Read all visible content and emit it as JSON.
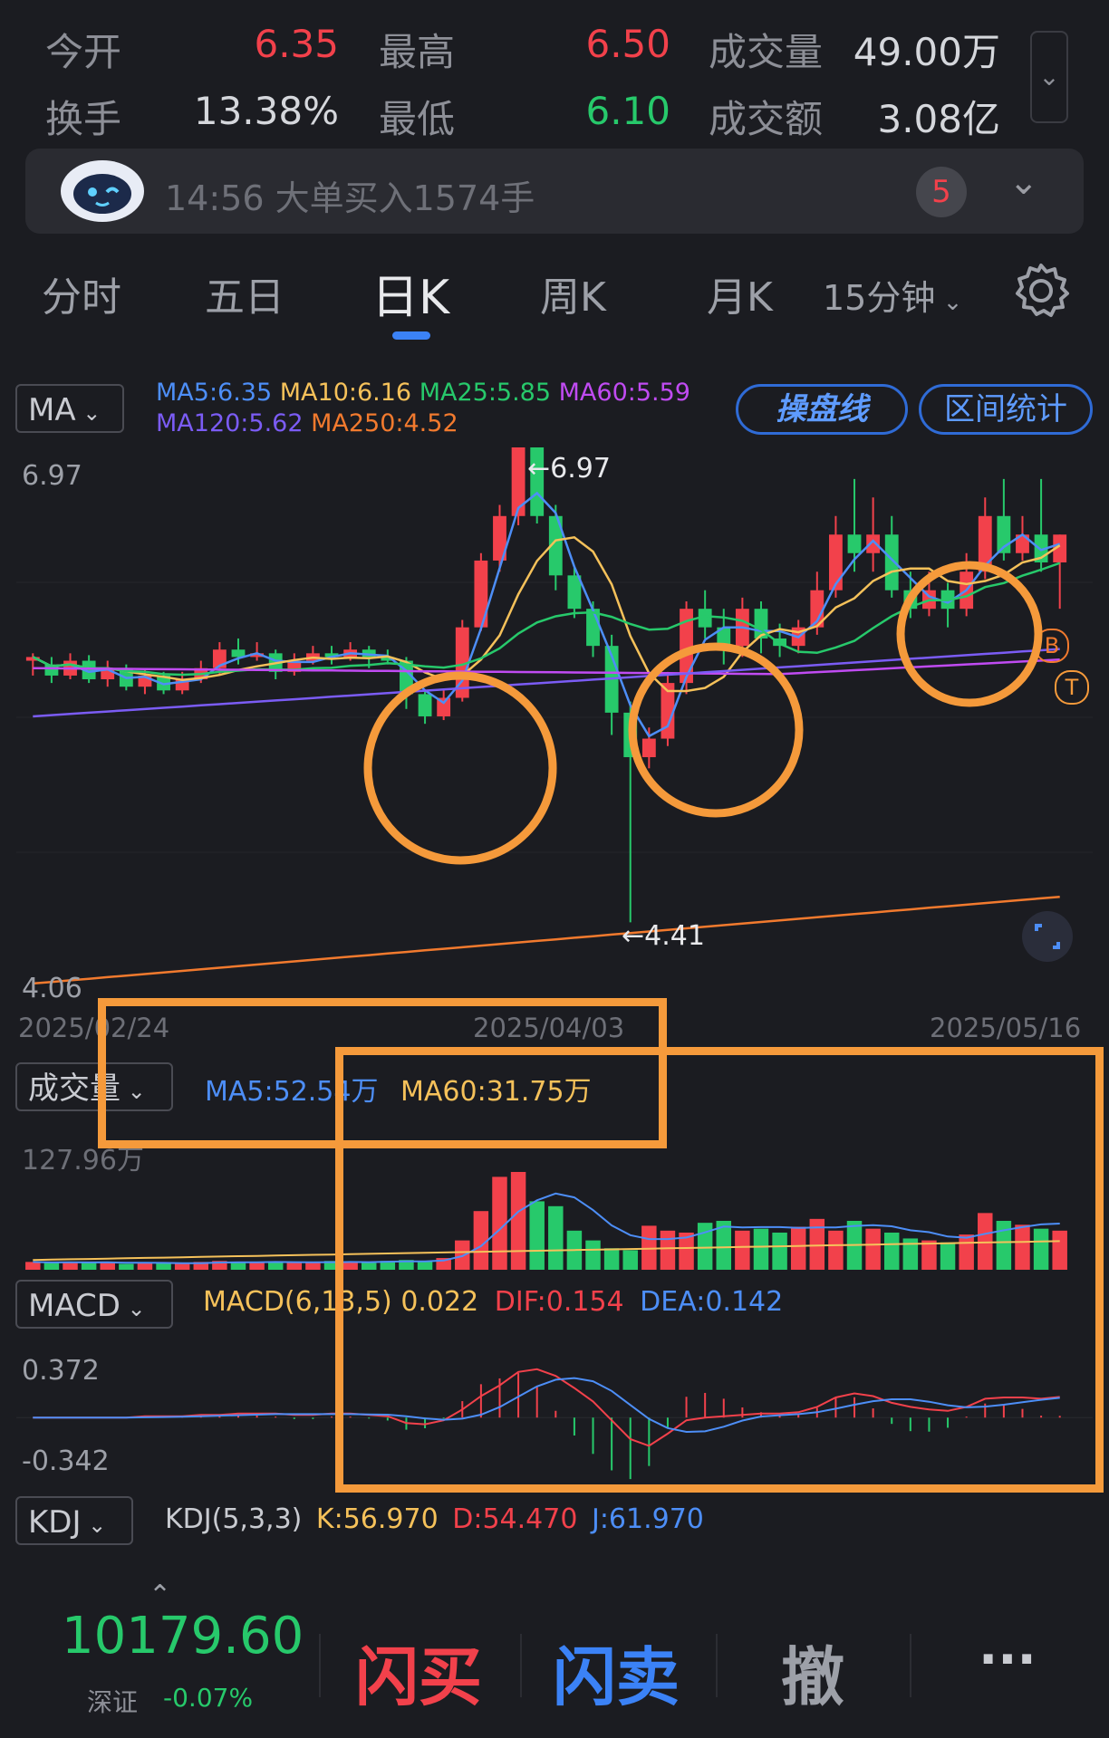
{
  "quote": {
    "open_label": "今开",
    "open_value": "6.35",
    "high_label": "最高",
    "high_value": "6.50",
    "volume_label": "成交量",
    "volume_value": "49.00万",
    "turnover_label": "换手",
    "turnover_value": "13.38%",
    "low_label": "最低",
    "low_value": "6.10",
    "amount_label": "成交额",
    "amount_value": "3.08亿"
  },
  "notice": {
    "text": "14:56 大单买入1574手",
    "badge": "5"
  },
  "tabs": [
    "分时",
    "五日",
    "日K",
    "周K",
    "月K",
    "15分钟"
  ],
  "active_tab": "日K",
  "main_chart": {
    "indicator_select": "MA",
    "ma_legend": [
      {
        "text": "MA5:6.35",
        "color": "#4d8ef7"
      },
      {
        "text": "MA10:6.16",
        "color": "#f5c15a"
      },
      {
        "text": "MA25:5.85",
        "color": "#27c96b"
      },
      {
        "text": "MA60:5.59",
        "color": "#c04bf2"
      },
      {
        "text": "MA120:5.62",
        "color": "#7b5cf5"
      },
      {
        "text": "MA250:4.52",
        "color": "#f27a2e"
      }
    ],
    "btn_caopanxian": "操盘线",
    "btn_interval": "区间统计",
    "y_top": "6.97",
    "y_bottom": "4.06",
    "max_mark": "←6.97",
    "min_mark": "←4.41",
    "dates": [
      "2025/02/24",
      "2025/04/03",
      "2025/05/16"
    ],
    "marker_b": "B",
    "marker_t": "T"
  },
  "volume_panel": {
    "select": "成交量",
    "ma5": "MA5:52.54万",
    "ma60": "MA60:31.75万",
    "y_top": "127.96万"
  },
  "macd_panel": {
    "select": "MACD",
    "params": "MACD(6,13,5)",
    "macd": "0.022",
    "dif": "DIF:0.154",
    "dea": "DEA:0.142",
    "y_top": "0.372",
    "y_bottom": "-0.342"
  },
  "kdj_panel": {
    "select": "KDJ",
    "params": "KDJ(5,3,3)",
    "k": "K:56.970",
    "d": "D:54.470",
    "j": "J:61.970"
  },
  "bottom": {
    "index_value": "10179.60",
    "index_name": "深证",
    "index_change": "-0.07%",
    "quick_buy": "闪买",
    "quick_sell": "闪卖",
    "cancel": "撤",
    "more": "···"
  },
  "colors": {
    "up": "#f2414b",
    "down": "#27c96b",
    "accent": "#3b82f6",
    "highlight": "#f59a3b"
  },
  "chart_data": {
    "type": "candlestick",
    "y_range": [
      4.06,
      6.97
    ],
    "x_range": [
      "2025/02/24",
      "2025/05/16"
    ],
    "candles": [
      [
        5.82,
        5.84,
        5.86,
        5.74
      ],
      [
        5.8,
        5.74,
        5.84,
        5.7
      ],
      [
        5.74,
        5.82,
        5.86,
        5.72
      ],
      [
        5.82,
        5.72,
        5.85,
        5.7
      ],
      [
        5.72,
        5.78,
        5.82,
        5.68
      ],
      [
        5.78,
        5.68,
        5.8,
        5.66
      ],
      [
        5.68,
        5.74,
        5.78,
        5.64
      ],
      [
        5.74,
        5.66,
        5.76,
        5.64
      ],
      [
        5.66,
        5.72,
        5.76,
        5.64
      ],
      [
        5.72,
        5.78,
        5.82,
        5.7
      ],
      [
        5.78,
        5.88,
        5.92,
        5.74
      ],
      [
        5.88,
        5.84,
        5.94,
        5.8
      ],
      [
        5.84,
        5.86,
        5.92,
        5.82
      ],
      [
        5.86,
        5.76,
        5.88,
        5.72
      ],
      [
        5.76,
        5.82,
        5.86,
        5.74
      ],
      [
        5.82,
        5.86,
        5.9,
        5.8
      ],
      [
        5.86,
        5.84,
        5.9,
        5.8
      ],
      [
        5.84,
        5.88,
        5.92,
        5.82
      ],
      [
        5.88,
        5.84,
        5.9,
        5.78
      ],
      [
        5.84,
        5.82,
        5.88,
        5.8
      ],
      [
        5.82,
        5.64,
        5.84,
        5.56
      ],
      [
        5.64,
        5.52,
        5.66,
        5.48
      ],
      [
        5.52,
        5.62,
        5.66,
        5.5
      ],
      [
        5.62,
        6.0,
        6.04,
        5.6
      ],
      [
        6.0,
        6.36,
        6.4,
        5.98
      ],
      [
        6.36,
        6.6,
        6.66,
        6.3
      ],
      [
        6.6,
        6.97,
        6.97,
        6.55
      ],
      [
        6.97,
        6.6,
        6.97,
        6.56
      ],
      [
        6.6,
        6.28,
        6.66,
        6.2
      ],
      [
        6.28,
        6.1,
        6.32,
        6.05
      ],
      [
        6.1,
        5.9,
        6.14,
        5.84
      ],
      [
        5.9,
        5.54,
        5.96,
        5.42
      ],
      [
        5.54,
        5.3,
        5.6,
        4.41
      ],
      [
        5.3,
        5.4,
        5.46,
        5.24
      ],
      [
        5.4,
        5.7,
        5.76,
        5.36
      ],
      [
        5.7,
        6.1,
        6.14,
        5.64
      ],
      [
        6.1,
        6.0,
        6.2,
        5.94
      ],
      [
        6.0,
        5.9,
        6.1,
        5.8
      ],
      [
        5.9,
        6.1,
        6.16,
        5.84
      ],
      [
        6.1,
        5.94,
        6.14,
        5.86
      ],
      [
        5.94,
        5.9,
        6.02,
        5.84
      ],
      [
        5.9,
        6.0,
        6.04,
        5.86
      ],
      [
        6.0,
        6.2,
        6.3,
        5.96
      ],
      [
        6.2,
        6.5,
        6.6,
        6.16
      ],
      [
        6.5,
        6.4,
        6.8,
        6.3
      ],
      [
        6.4,
        6.5,
        6.7,
        6.3
      ],
      [
        6.5,
        6.2,
        6.6,
        6.16
      ],
      [
        6.2,
        6.1,
        6.3,
        6.05
      ],
      [
        6.1,
        6.2,
        6.3,
        6.06
      ],
      [
        6.2,
        6.1,
        6.24,
        6.0
      ],
      [
        6.1,
        6.3,
        6.4,
        6.06
      ],
      [
        6.3,
        6.6,
        6.7,
        6.26
      ],
      [
        6.6,
        6.4,
        6.8,
        6.36
      ],
      [
        6.4,
        6.5,
        6.6,
        6.36
      ],
      [
        6.5,
        6.35,
        6.8,
        6.3
      ],
      [
        6.35,
        6.5,
        6.5,
        6.1
      ]
    ],
    "volume_top": "127.96万",
    "macd_range": [
      -0.342,
      0.372
    ]
  }
}
